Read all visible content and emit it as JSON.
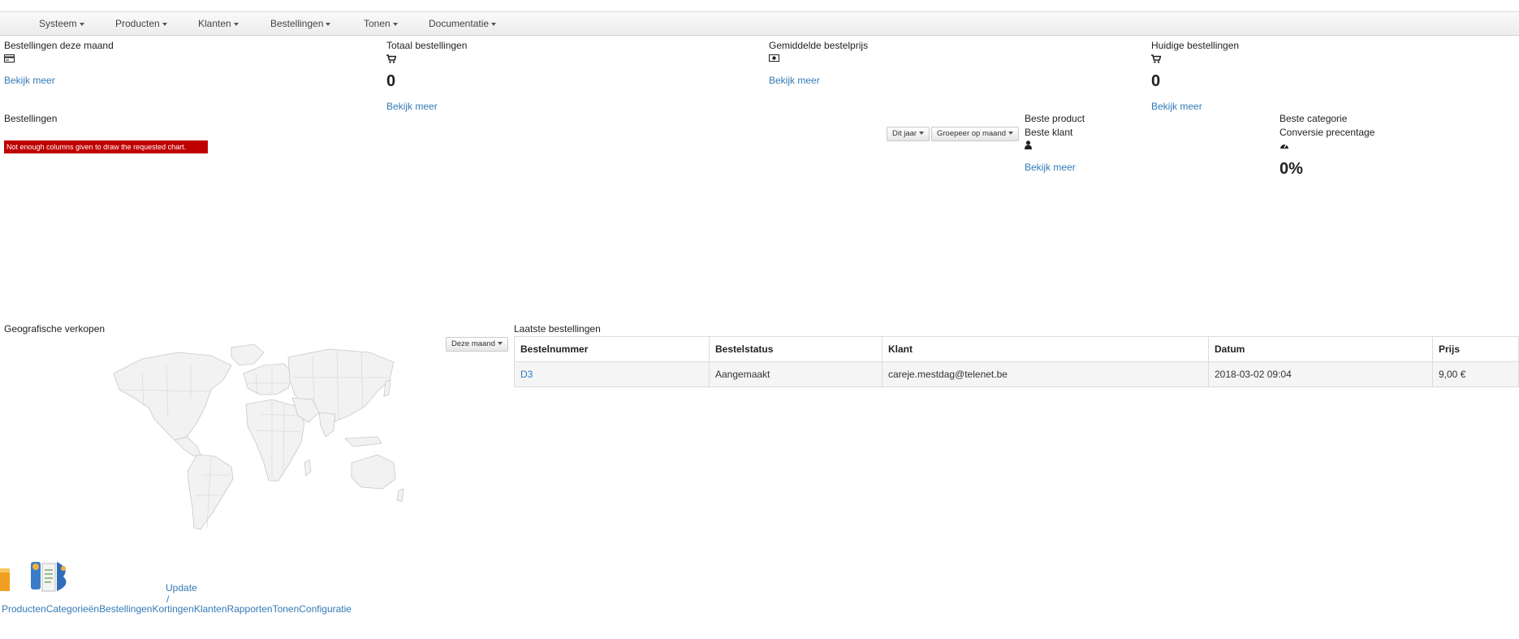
{
  "nav": {
    "items": [
      "Systeem",
      "Producten",
      "Klanten",
      "Bestellingen",
      "Tonen",
      "Documentatie"
    ]
  },
  "stats": {
    "orders_month": {
      "title": "Bestellingen deze maand",
      "link": "Bekijk meer",
      "icon": "credit-card-icon"
    },
    "total_orders": {
      "title": "Totaal bestellingen",
      "value": "0",
      "link": "Bekijk meer",
      "icon": "cart-icon"
    },
    "avg_price": {
      "title": "Gemiddelde bestelprijs",
      "link": "Bekijk meer",
      "icon": "money-icon"
    },
    "current_orders": {
      "title": "Huidige bestellingen",
      "value": "0",
      "link": "Bekijk meer",
      "icon": "cart-icon"
    }
  },
  "orders_chart": {
    "title": "Bestellingen",
    "error": "Not enough columns given to draw the requested chart.",
    "period_button": "Dit jaar",
    "group_button": "Groepeer op maand"
  },
  "best": {
    "product_title": "Beste product",
    "customer_title": "Beste klant",
    "customer_link": "Bekijk meer",
    "category_title": "Beste categorie",
    "conversion_title": "Conversie precentage",
    "conversion_value": "0%"
  },
  "geo": {
    "title": "Geografische verkopen",
    "period_button": "Deze maand"
  },
  "latest": {
    "title": "Laatste bestellingen",
    "columns": [
      "Bestelnummer",
      "Bestelstatus",
      "Klant",
      "Datum",
      "Prijs"
    ],
    "rows": [
      {
        "number": "D3",
        "status": "Aangemaakt",
        "customer": "careje.mestdag@telenet.be",
        "date": "2018-03-02 09:04",
        "price": "9,00 €"
      }
    ]
  },
  "bottom": {
    "update_link": "Update",
    "slash": "/",
    "overlapping_links": "ProductenCategorieënBestellingenKortingenKlantenRapportenTonenConfiguratie"
  },
  "colors": {
    "link": "#337ab7",
    "error": "#c00000"
  }
}
